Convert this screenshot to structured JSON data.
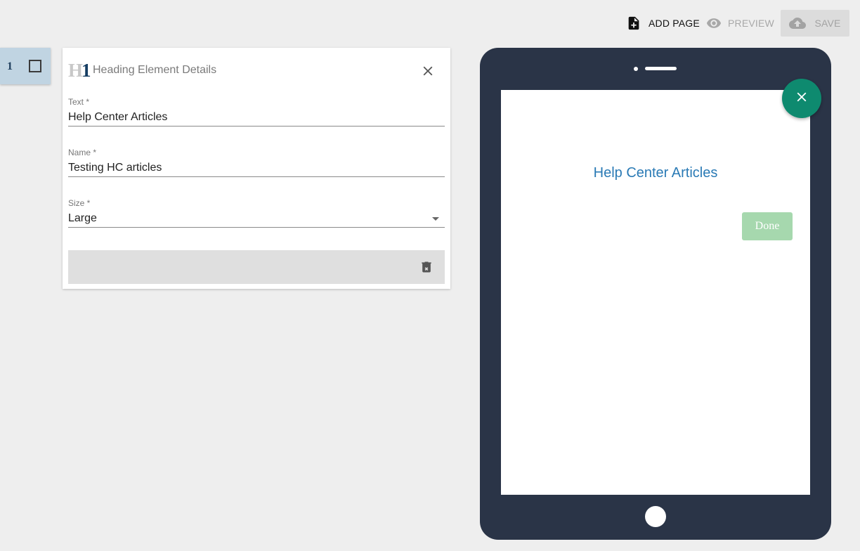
{
  "toolbar": {
    "add_page_label": "ADD PAGE",
    "preview_label": "PREVIEW",
    "save_label": "SAVE"
  },
  "page_tab": {
    "number": "1"
  },
  "panel": {
    "icon_text_h": "H",
    "icon_text_1": "1",
    "title": "Heading Element Details",
    "fields": {
      "text": {
        "label": "Text *",
        "value": "Help Center Articles"
      },
      "name": {
        "label": "Name *",
        "value": "Testing HC articles"
      },
      "size": {
        "label": "Size *",
        "value": "Large"
      }
    }
  },
  "preview": {
    "heading": "Help Center Articles",
    "done_label": "Done"
  },
  "colors": {
    "background": "#eeeeee",
    "tablet_frame": "#2a3447",
    "fab": "#0e8a6f",
    "heading_text": "#2a7ab5",
    "done_button": "#a6d8ae",
    "page_tab": "#c0d4e2"
  },
  "icons": {
    "add_page": "note-add-icon",
    "preview": "eye-icon",
    "save": "cloud-upload-icon",
    "panel_close": "close-icon",
    "delete": "trash-icon",
    "fab": "close-icon",
    "page_select": "checkbox-icon"
  }
}
